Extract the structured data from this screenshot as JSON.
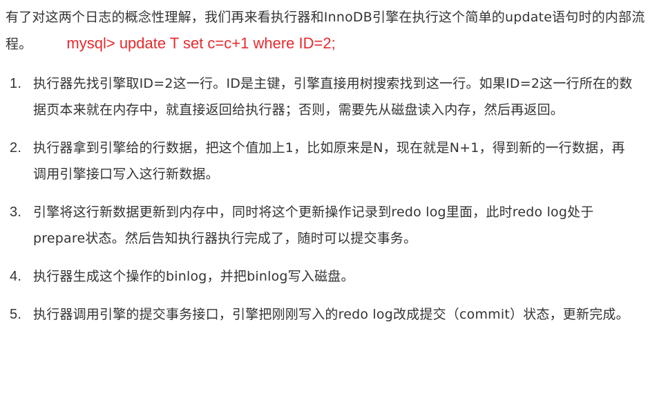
{
  "intro": {
    "text": "有了对这两个日志的概念性理解，我们再来看执行器和InnoDB引擎在执行这个简单的update语句时的内部流程。",
    "sql": "mysql> update T set c=c+1 where ID=2;"
  },
  "steps": [
    {
      "num": "1.",
      "text": "执行器先找引擎取ID=2这一行。ID是主键，引擎直接用树搜索找到这一行。如果ID=2这一行所在的数据页本来就在内存中，就直接返回给执行器；否则，需要先从磁盘读入内存，然后再返回。"
    },
    {
      "num": "2.",
      "text": "执行器拿到引擎给的行数据，把这个值加上1，比如原来是N，现在就是N+1，得到新的一行数据，再调用引擎接口写入这行新数据。"
    },
    {
      "num": "3.",
      "text": "引擎将这行新数据更新到内存中，同时将这个更新操作记录到redo log里面，此时redo log处于prepare状态。然后告知执行器执行完成了，随时可以提交事务。"
    },
    {
      "num": "4.",
      "text": "执行器生成这个操作的binlog，并把binlog写入磁盘。"
    },
    {
      "num": "5.",
      "text": "执行器调用引擎的提交事务接口，引擎把刚刚写入的redo log改成提交（commit）状态，更新完成。"
    }
  ]
}
